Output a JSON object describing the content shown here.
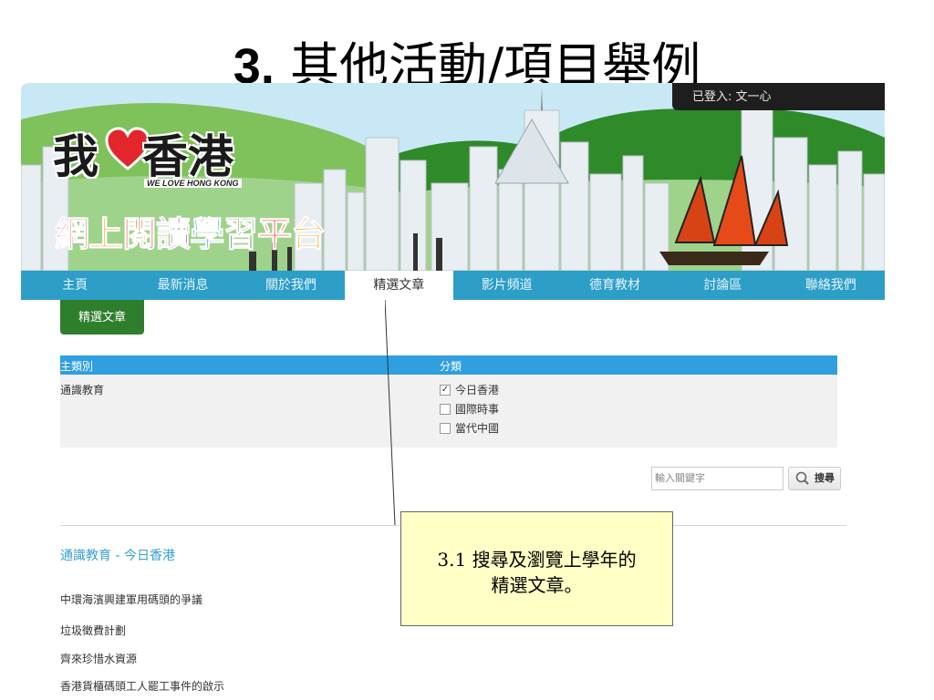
{
  "slide": {
    "title_number": "3.",
    "title_text": " 其他活動/項目舉例"
  },
  "login": {
    "text": "已登入: 文一心"
  },
  "logo": {
    "word1": "我",
    "word2": "香港",
    "tagline": "WE LOVE HONG KONG",
    "subtitle_chars": [
      "網",
      "上",
      "閱",
      "讀",
      "學",
      "習",
      "平",
      "台"
    ],
    "subtitle_colors": [
      "#e53935",
      "#f9a825",
      "#e53935",
      "#8e24aa",
      "#1e88e5",
      "#2e7d32",
      "#e53935",
      "#f9a825"
    ]
  },
  "nav": {
    "items": [
      "主頁",
      "最新消息",
      "關於我們",
      "精選文章",
      "影片頻道",
      "德育教材",
      "討論區",
      "聯絡我們"
    ],
    "active_index": 3
  },
  "section_tab": {
    "label": "精選文章"
  },
  "filter": {
    "main_header": "主類別",
    "sub_header": "分類",
    "main_value": "通識教育",
    "categories": [
      {
        "label": "今日香港",
        "checked": true
      },
      {
        "label": "國際時事",
        "checked": false
      },
      {
        "label": "當代中國",
        "checked": false
      }
    ]
  },
  "search": {
    "placeholder": "輸入關鍵字",
    "button_label": "搜尋"
  },
  "results": {
    "title": "通識教育 - 今日香港",
    "articles": [
      "中環海濱興建軍用碼頭的爭議",
      "垃圾徵費計劃",
      "齊來珍惜水資源",
      "香港貨櫃碼頭工人罷工事件的啟示"
    ]
  },
  "callout": {
    "line1": "3.1 搜尋及瀏覽上學年的",
    "line2": "精選文章。"
  },
  "colors": {
    "nav_bg": "#2c9ec8",
    "filter_header": "#2f9fe0",
    "section_tab": "#2f7e2c",
    "callout_bg": "#ffffc6"
  }
}
